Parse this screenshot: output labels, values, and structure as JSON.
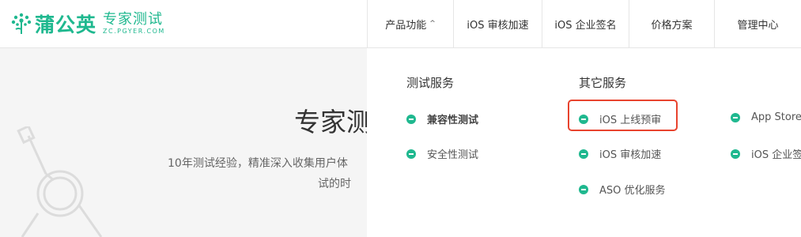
{
  "brand": {
    "name": "蒲公英",
    "product": "专家测试",
    "domain": "ZC.PGYER.COM",
    "color": "#1fb88f"
  },
  "nav": {
    "items": [
      {
        "label": "产品功能",
        "caret": "^"
      },
      {
        "label": "iOS 审核加速"
      },
      {
        "label": "iOS 企业签名"
      },
      {
        "label": "价格方案"
      },
      {
        "label": "管理中心"
      }
    ]
  },
  "hero": {
    "title": "专家测",
    "desc_line1": "10年测试经验，精准深入收集用户体",
    "desc_line2": "试的时"
  },
  "dropdown": {
    "col1": {
      "title": "测试服务",
      "items": [
        "兼容性测试",
        "安全性测试"
      ]
    },
    "col2": {
      "title": "其它服务",
      "items": [
        "iOS 上线预审",
        "iOS 审核加速",
        "ASO 优化服务"
      ]
    },
    "col3": {
      "items": [
        "App Store",
        "iOS 企业签"
      ]
    },
    "highlight_color": "#e8432e",
    "icon": "arrow-circle-icon"
  }
}
